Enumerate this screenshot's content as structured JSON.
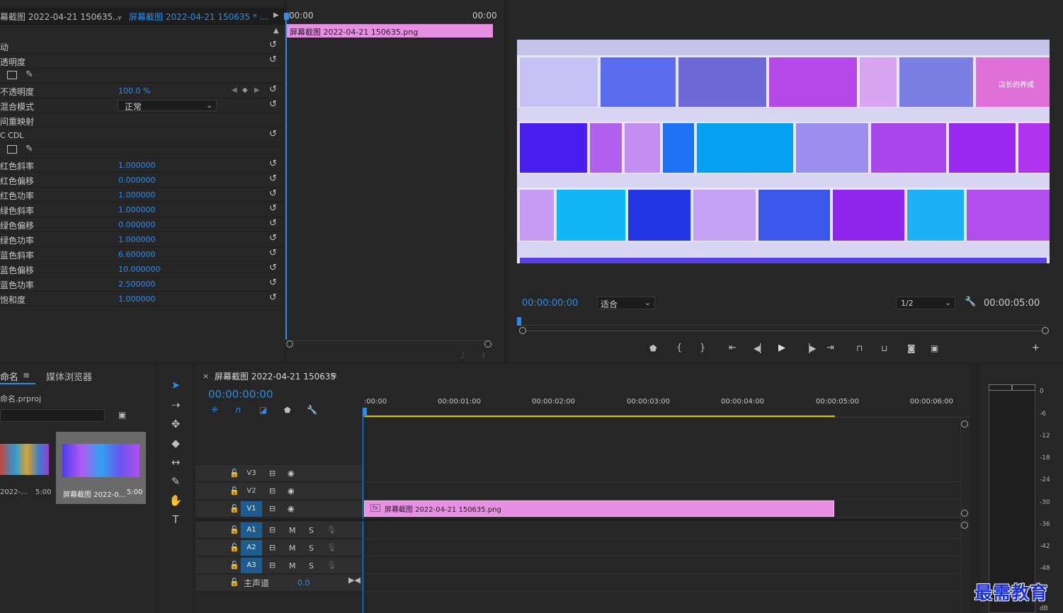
{
  "effect_controls": {
    "source_tab": "幕截图 2022-04-21 150635...",
    "clip_tab": "屏幕截图 2022-04-21 150635 * ...",
    "tc_start": "00:00",
    "tc_end": "00:00",
    "clip_name": "屏幕截图 2022-04-21  150635.png",
    "rows": [
      {
        "label": "动",
        "value": ""
      },
      {
        "label": "透明度",
        "value": ""
      },
      {
        "label": "",
        "value": ""
      },
      {
        "label": "不透明度",
        "value": "100.0 %"
      },
      {
        "label": "混合模式",
        "value": "正常"
      },
      {
        "label": "间重映射",
        "value": ""
      },
      {
        "label": "C CDL",
        "value": ""
      },
      {
        "label": "",
        "value": ""
      },
      {
        "label": "红色斜率",
        "value": "1.000000"
      },
      {
        "label": "红色偏移",
        "value": "0.000000"
      },
      {
        "label": "红色功率",
        "value": "1.000000"
      },
      {
        "label": "绿色斜率",
        "value": "1.000000"
      },
      {
        "label": "绿色偏移",
        "value": "0.000000"
      },
      {
        "label": "绿色功率",
        "value": "1.000000"
      },
      {
        "label": "蓝色斜率",
        "value": "6.600000"
      },
      {
        "label": "蓝色偏移",
        "value": "10.000000"
      },
      {
        "label": "蓝色功率",
        "value": "2.500000"
      },
      {
        "label": "饱和度",
        "value": "1.000000"
      }
    ]
  },
  "program_monitor": {
    "timecode": "00:00:00:00",
    "fit": "适合",
    "resolution": "1/2",
    "duration": "00:00:05:00",
    "overlay_text": "店长的养成"
  },
  "project": {
    "tab_project": "命名",
    "tab_media": "媒体浏览器",
    "file": "命名.prproj",
    "items": [
      {
        "name": "2022-...",
        "duration": "5:00"
      },
      {
        "name": "屏幕截图 2022-0...",
        "duration": "5:00"
      }
    ]
  },
  "timeline": {
    "title": "屏幕截图 2022-04-21 150635",
    "timecode": "00:00:00:00",
    "ruler": [
      ":00:00",
      "00:00:01:00",
      "00:00:02:00",
      "00:00:03:00",
      "00:00:04:00",
      "00:00:05:00",
      "00:00:06:00"
    ],
    "video_tracks": [
      "V3",
      "V2",
      "V1"
    ],
    "audio_tracks": [
      "A1",
      "A2",
      "A3"
    ],
    "master_label": "主声道",
    "master_value": "0.0",
    "clip_name": "屏幕截图 2022-04-21  150635.png",
    "fx_label": "fx",
    "mute": "M",
    "solo": "S"
  },
  "meter": {
    "labels": [
      "0",
      "-6",
      "-12",
      "-18",
      "-24",
      "-30",
      "-36",
      "-42",
      "-48",
      "dB"
    ]
  },
  "watermark": "最需教育",
  "colors": {
    "accent": "#2d8ceb",
    "clip_pink": "#e78fe3",
    "track_on": "#1e5b8f",
    "playhead_bar": "#e3c400"
  }
}
